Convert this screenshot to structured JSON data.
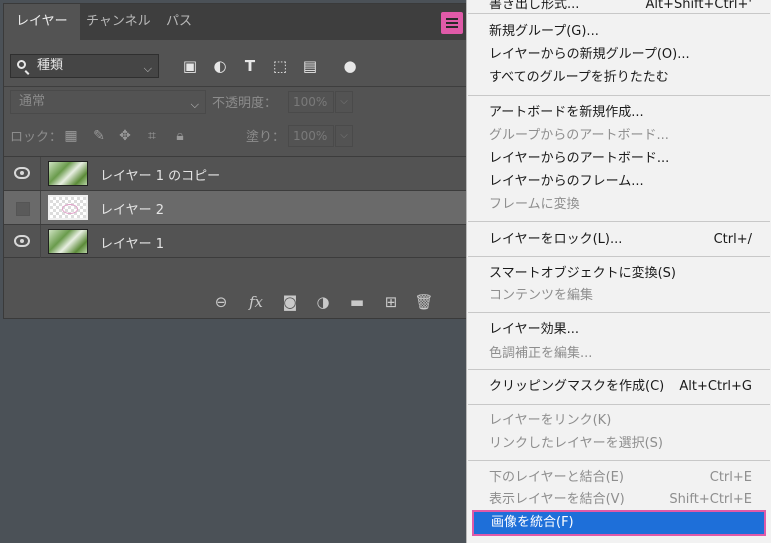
{
  "panel": {
    "tabs": [
      "レイヤー",
      "チャンネル",
      "パス"
    ],
    "filter": {
      "value": "種類"
    },
    "blend_mode": "通常",
    "opacity_label": "不透明度：",
    "opacity_value": "100%",
    "lock_label": "ロック：",
    "fill_label": "塗り：",
    "fill_value": "100%",
    "layers": [
      {
        "name": "レイヤー 1 のコピー",
        "visible": true
      },
      {
        "name": "レイヤー 2",
        "visible": false,
        "selected": true
      },
      {
        "name": "レイヤー 1",
        "visible": true
      }
    ]
  },
  "context_menu": {
    "cut_item": {
      "label": "書き出し形式...",
      "shortcut": "Alt+Shift+Ctrl+'"
    },
    "groups": [
      [
        {
          "label": "新規グループ(G)..."
        },
        {
          "label": "レイヤーからの新規グループ(O)..."
        },
        {
          "label": "すべてのグループを折りたたむ"
        }
      ],
      [
        {
          "label": "アートボードを新規作成..."
        },
        {
          "label": "グループからのアートボード...",
          "disabled": true
        },
        {
          "label": "レイヤーからのアートボード..."
        },
        {
          "label": "レイヤーからのフレーム..."
        },
        {
          "label": "フレームに変換",
          "disabled": true
        }
      ],
      [
        {
          "label": "レイヤーをロック(L)...",
          "shortcut": "Ctrl+/"
        }
      ],
      [
        {
          "label": "スマートオブジェクトに変換(S)"
        },
        {
          "label": "コンテンツを編集",
          "disabled": true
        }
      ],
      [
        {
          "label": "レイヤー効果..."
        },
        {
          "label": "色調補正を編集...",
          "disabled": true
        }
      ],
      [
        {
          "label": "クリッピングマスクを作成(C)",
          "shortcut": "Alt+Ctrl+G"
        }
      ],
      [
        {
          "label": "レイヤーをリンク(K)",
          "disabled": true
        },
        {
          "label": "リンクしたレイヤーを選択(S)",
          "disabled": true
        }
      ],
      [
        {
          "label": "下のレイヤーと結合(E)",
          "shortcut": "Ctrl+E",
          "disabled": true
        },
        {
          "label": "表示レイヤーを結合(V)",
          "shortcut": "Shift+Ctrl+E",
          "disabled": true
        },
        {
          "label": "画像を統合(F)",
          "highlighted": true
        }
      ]
    ]
  },
  "colors": {
    "accent": "#1e6fd9",
    "highlight_border": "#e05aa8",
    "panel_bg": "#535353",
    "canvas_bg": "#4b5157"
  }
}
